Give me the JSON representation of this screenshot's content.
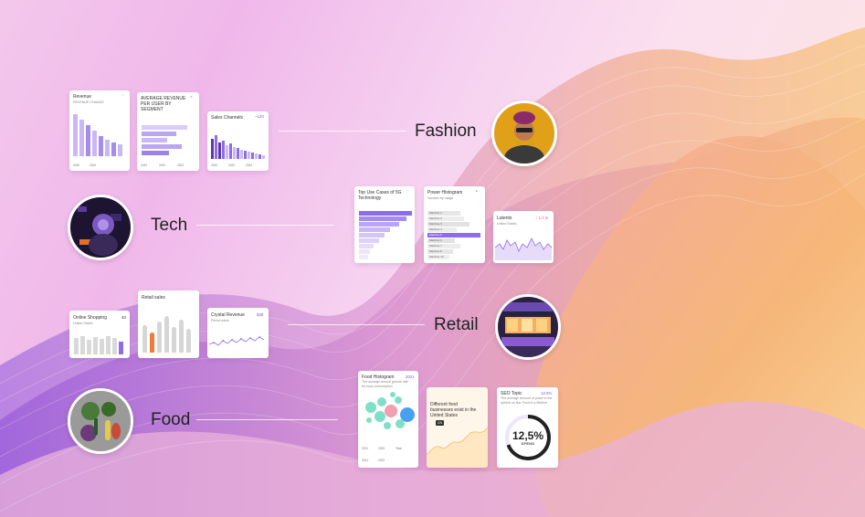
{
  "categories": {
    "fashion": "Fashion",
    "tech": "Tech",
    "retail": "Retail",
    "food": "Food"
  },
  "colors": {
    "accent": "#8e6be8",
    "accent_light": "#c9b8f5",
    "orange": "#f07a3a",
    "teal": "#7fe0c8"
  },
  "cards": {
    "revenue": {
      "title": "Revenue",
      "subtitle": "REVENUE CHANGE",
      "icon": "more-icon",
      "ticks": [
        "2020",
        "2020"
      ]
    },
    "arpu": {
      "title": "AVERAGE REVENUE PER USER BY SEGMENT",
      "icon": "close-icon",
      "ticks": [
        "2020",
        "2020",
        "2022"
      ]
    },
    "sales_channels": {
      "title": "Sales Channels",
      "value": "~120",
      "ticks": [
        "2020",
        "2020",
        "2022"
      ]
    },
    "top_use_cases": {
      "title": "Top Use Cases of 5G Technology",
      "icon": "more-icon"
    },
    "power_histogram": {
      "title": "Power Histogram",
      "subtitle": "Number by usage",
      "icon": "warning-icon",
      "rows": [
        "Machine 1",
        "Machine 2",
        "Machine 3",
        "Machine 4",
        "Machine 5",
        "Machine 6",
        "Machine 7",
        "Machine 8",
        "Machine 10"
      ]
    },
    "latents": {
      "title": "Latents",
      "subtitle": "United States",
      "value": "↑ 1.3 m"
    },
    "online_shopping": {
      "title": "Online Shopping",
      "subtitle": "United States",
      "value": "40"
    },
    "retail_sales": {
      "title": "Retail sales"
    },
    "crystal_revenue": {
      "title": "Crystal Revenue",
      "subtitle": "Period sales",
      "value": "$38"
    },
    "food_histogram": {
      "title": "Food Histogram",
      "value": "2021",
      "subtitle": "The average annual growth rate for food consumption",
      "legend": [
        "2021",
        "2020",
        "Total",
        "2021",
        "2020"
      ]
    },
    "fast_food": {
      "title": "Different food businesses exist in the United States",
      "tag": "CN"
    },
    "seo_topic": {
      "title": "SEO Topic",
      "value": "12.5%",
      "subtitle": "The average amount of place in the sphere on Bar Food in a lifetime",
      "gauge_value": "12,5%",
      "gauge_label": "SPEND"
    }
  }
}
